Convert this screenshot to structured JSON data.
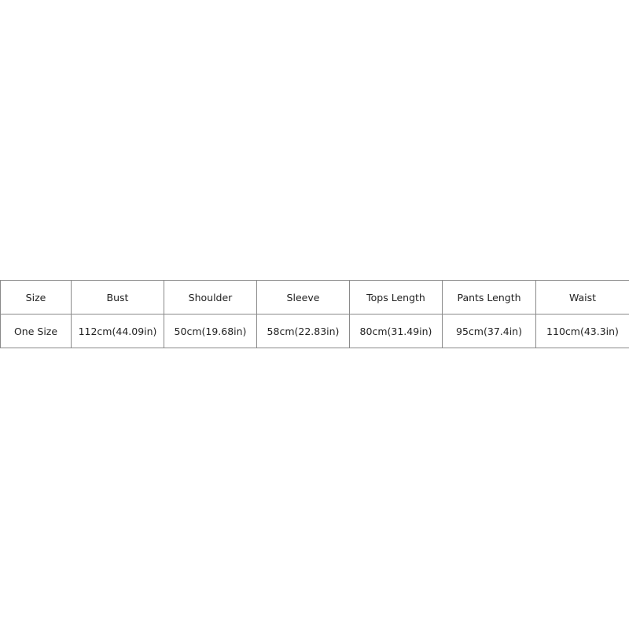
{
  "size_chart": {
    "headers": [
      "Size",
      "Bust",
      "Shoulder",
      "Sleeve",
      "Tops Length",
      "Pants Length",
      "Waist"
    ],
    "rows": [
      [
        "One Size",
        "112cm(44.09in)",
        "50cm(19.68in)",
        "58cm(22.83in)",
        "80cm(31.49in)",
        "95cm(37.4in)",
        "110cm(43.3in)"
      ]
    ]
  }
}
